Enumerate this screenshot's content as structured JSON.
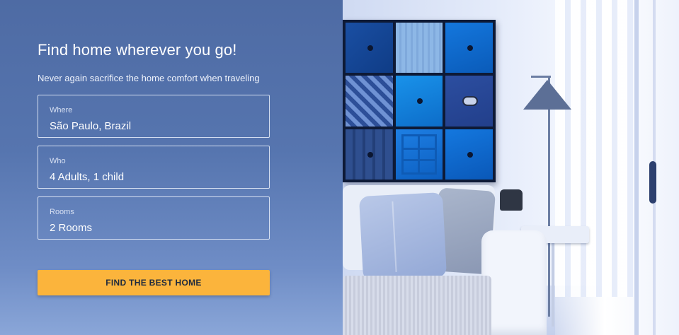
{
  "hero": {
    "title": "Find home wherever you go!",
    "subtitle": "Never again sacrifice the home comfort when traveling"
  },
  "search_form": {
    "where": {
      "label": "Where",
      "value": "São Paulo, Brazil"
    },
    "who": {
      "label": "Who",
      "value": "4 Adults, 1 child"
    },
    "rooms": {
      "label": "Rooms",
      "value": "2 Rooms"
    },
    "submit_label": "FIND THE BEST HOME"
  },
  "colors": {
    "panel_blue": "#4f6fa8",
    "cta_accent": "#fbb43c",
    "text_white": "#ffffff"
  }
}
